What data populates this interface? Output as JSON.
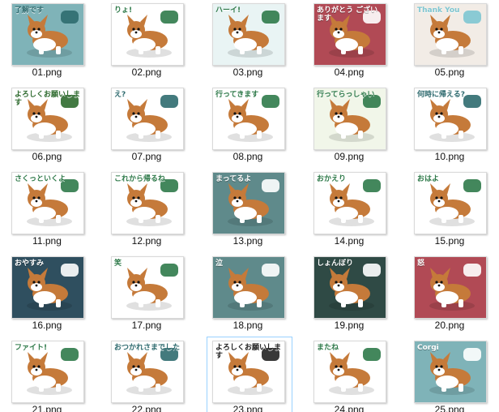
{
  "files": [
    {
      "name": "01.png",
      "caption": "了解です",
      "bg": "#7fb3b8",
      "accent": "#2f6b6f"
    },
    {
      "name": "02.png",
      "caption": "りょ!",
      "bg": "#ffffff",
      "accent": "#2f7a4a"
    },
    {
      "name": "03.png",
      "caption": "ハーイ!",
      "bg": "#e9f4f4",
      "accent": "#2f7a4a"
    },
    {
      "name": "04.png",
      "caption": "ありがとう ございます",
      "bg": "#b14a55",
      "accent": "#ffffff"
    },
    {
      "name": "05.png",
      "caption": "Thank You",
      "bg": "#f2ece6",
      "accent": "#7ec6d1"
    },
    {
      "name": "06.png",
      "caption": "よろしくお願いします",
      "bg": "#ffffff",
      "accent": "#2f6b2f"
    },
    {
      "name": "07.png",
      "caption": "え?",
      "bg": "#ffffff",
      "accent": "#2f6b6f"
    },
    {
      "name": "08.png",
      "caption": "行ってきます",
      "bg": "#ffffff",
      "accent": "#2f7a4a"
    },
    {
      "name": "09.png",
      "caption": "行ってらっしゃい",
      "bg": "#f1f6e9",
      "accent": "#2f7a4a"
    },
    {
      "name": "10.png",
      "caption": "何時に帰える?",
      "bg": "#ffffff",
      "accent": "#2f6b6f"
    },
    {
      "name": "11.png",
      "caption": "さくっといくよ",
      "bg": "#ffffff",
      "accent": "#2f7a4a"
    },
    {
      "name": "12.png",
      "caption": "これから帰るね",
      "bg": "#ffffff",
      "accent": "#2f7a4a"
    },
    {
      "name": "13.png",
      "caption": "まってるよ",
      "bg": "#5f8a8b",
      "accent": "#ffffff"
    },
    {
      "name": "14.png",
      "caption": "おかえり",
      "bg": "#ffffff",
      "accent": "#2f7a4a"
    },
    {
      "name": "15.png",
      "caption": "おはよ",
      "bg": "#ffffff",
      "accent": "#2f7a4a"
    },
    {
      "name": "16.png",
      "caption": "おやすみ",
      "bg": "#2f4f5f",
      "accent": "#ffffff"
    },
    {
      "name": "17.png",
      "caption": "笑",
      "bg": "#ffffff",
      "accent": "#2f7a4a"
    },
    {
      "name": "18.png",
      "caption": "泣",
      "bg": "#5f8a8b",
      "accent": "#ffffff"
    },
    {
      "name": "19.png",
      "caption": "しょんぼり",
      "bg": "#2f4a45",
      "accent": "#ffffff"
    },
    {
      "name": "20.png",
      "caption": "怒",
      "bg": "#b14a55",
      "accent": "#ffffff"
    },
    {
      "name": "21.png",
      "caption": "ファイト!",
      "bg": "#ffffff",
      "accent": "#2f7a4a"
    },
    {
      "name": "22.png",
      "caption": "おつかれさまでした",
      "bg": "#ffffff",
      "accent": "#2f6b6f"
    },
    {
      "name": "23.png",
      "caption": "よろしくお願いします",
      "bg": "#ffffff",
      "accent": "#222222"
    },
    {
      "name": "24.png",
      "caption": "またね",
      "bg": "#ffffff",
      "accent": "#2f7a4a"
    },
    {
      "name": "25.png",
      "caption": "Corgi",
      "bg": "#7fb3b8",
      "accent": "#ffffff"
    }
  ],
  "selected_index": 22,
  "colors": {
    "dog_orange": "#c57a3a",
    "dog_white": "#ffffff",
    "selection_outline": "#99d1ff"
  }
}
